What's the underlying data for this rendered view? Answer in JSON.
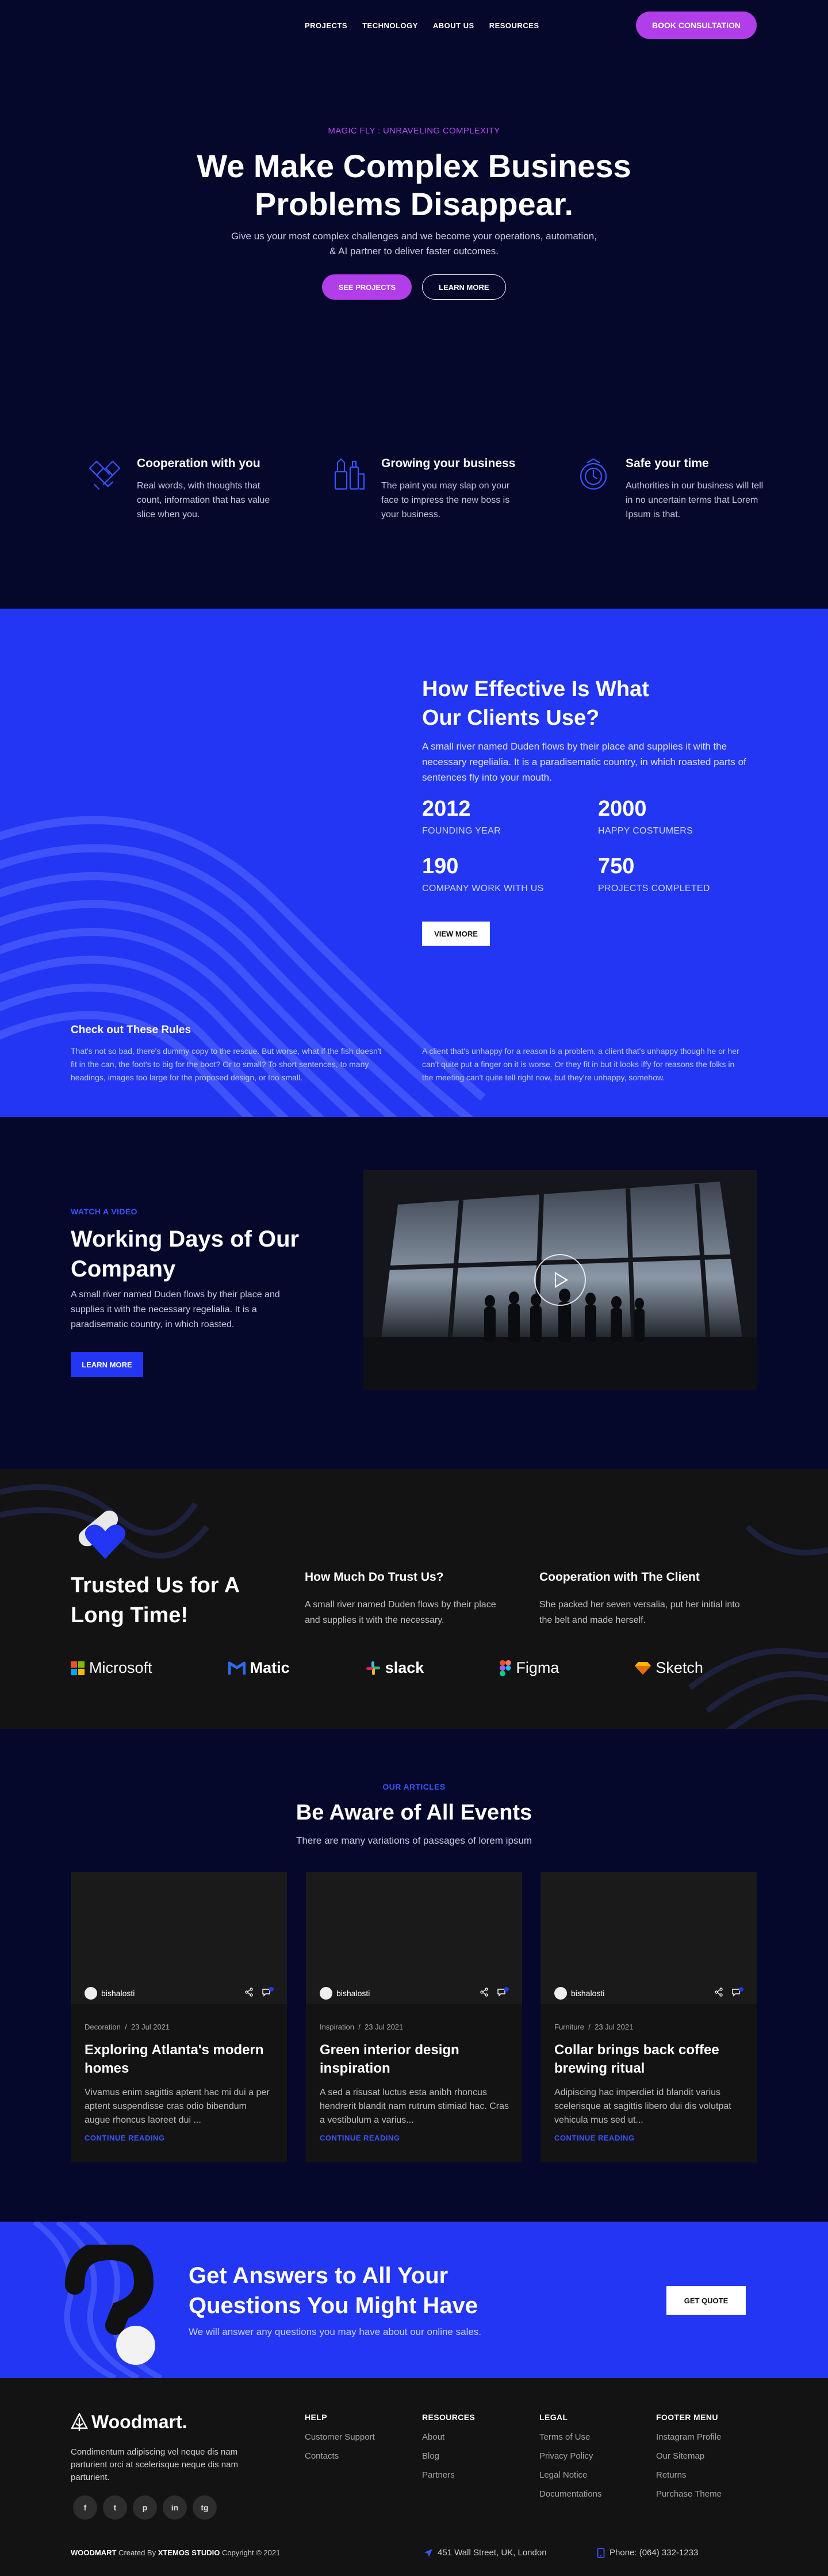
{
  "nav": {
    "links": [
      "PROJECTS",
      "TECHNOLOGY",
      "ABOUT US",
      "RESOURCES"
    ],
    "cta": "BOOK CONSULTATION"
  },
  "hero": {
    "eyebrow": "MAGIC FLY : UNRAVELING COMPLEXITY",
    "title": "We Make Complex Business Problems Disappear.",
    "subtitle": "Give us your most complex challenges and we become your operations, automation, & AI partner to deliver faster outcomes.",
    "primary_button": "SEE PROJECTS",
    "secondary_button": "LEARN MORE"
  },
  "features": [
    {
      "icon": "handshake-icon",
      "title": "Cooperation with you",
      "text": "Real words, with thoughts that count, information that has value slice when you."
    },
    {
      "icon": "office-supplies-icon",
      "title": "Growing your business",
      "text": "The paint you may slap on your face to impress the new boss is your business."
    },
    {
      "icon": "safe-time-icon",
      "title": "Safe your time",
      "text": "Authorities in our business will tell in no uncertain terms that Lorem Ipsum is that."
    }
  ],
  "stats": {
    "title": "How Effective Is What Our Clients Use?",
    "description": "A small river named Duden flows by their place and supplies it with the necessary regelialia. It is a paradisematic country, in which roasted parts of sentences fly into your mouth.",
    "items": [
      {
        "value": "2012",
        "label": "FOUNDING YEAR"
      },
      {
        "value": "2000",
        "label": "HAPPY COSTUMERS"
      },
      {
        "value": "190",
        "label": "COMPANY WORK WITH US"
      },
      {
        "value": "750",
        "label": "PROJECTS COMPLETED"
      }
    ],
    "button": "VIEW MORE",
    "rules_title": "Check out These Rules",
    "rules_left": "That's not so bad, there's dummy copy to the rescue. But worse, what if the fish doesn't fit in the can, the foot's to big for the boot? Or to small? To short sentences, to many headings, images too large for the proposed design, or too small.",
    "rules_right": "A client that's unhappy for a reason is a problem, a client that's unhappy though he or her can't quite put a finger on it is worse. Or they fit in but it looks iffy for reasons the folks in the meeting can't quite tell right now, but they're unhappy, somehow."
  },
  "video": {
    "eyebrow": "WATCH A VIDEO",
    "title": "Working Days of Our Company",
    "description": "A small river named Duden flows by their place and supplies it with the necessary regelialia. It is a paradisematic country, in which roasted.",
    "button": "LEARN MORE"
  },
  "trust": {
    "title": "Trusted Us for A Long Time!",
    "col1_title": "How Much Do Trust Us?",
    "col1_text": "A small river named Duden flows by their place and supplies it with the necessary.",
    "col2_title": "Cooperation with The Client",
    "col2_text": "She packed her seven versalia, put her initial into the belt and made herself.",
    "logos": [
      "Microsoft",
      "Matic",
      "slack",
      "Figma",
      "Sketch"
    ]
  },
  "articles": {
    "eyebrow": "OUR ARTICLES",
    "title": "Be Aware of All Events",
    "subtitle": "There are many variations of passages of lorem ipsum",
    "cards": [
      {
        "author": "bishalosti",
        "category": "Decoration",
        "date": "23 Jul 2021",
        "title": "Exploring Atlanta's modern homes",
        "text": "Vivamus enim sagittis aptent hac mi dui a per aptent suspendisse cras odio bibendum augue rhoncus laoreet dui ...",
        "link": "CONTINUE READING"
      },
      {
        "author": "bishalosti",
        "category": "Inspiration",
        "date": "23 Jul 2021",
        "title": "Green interior design inspiration",
        "text": "A sed a risusat luctus esta anibh rhoncus hendrerit blandit nam rutrum stimiad hac. Cras a vestibulum a varius...",
        "link": "CONTINUE READING"
      },
      {
        "author": "bishalosti",
        "category": "Furniture",
        "date": "23 Jul 2021",
        "title": "Collar brings back coffee brewing ritual",
        "text": "Adipiscing hac imperdiet id blandit varius scelerisque at sagittis libero dui dis volutpat vehicula mus sed ut...",
        "link": "CONTINUE READING"
      }
    ]
  },
  "cta": {
    "title": "Get Answers to All Your Questions You Might Have",
    "subtitle": "We will answer any questions you may have about our online sales.",
    "button": "GET QUOTE"
  },
  "footer": {
    "logo": "Woodmart.",
    "about": "Condimentum adipiscing vel neque dis nam parturient orci at scelerisque neque dis nam parturient.",
    "social": [
      "f",
      "t",
      "p",
      "in",
      "tg"
    ],
    "help_title": "HELP",
    "help_links": [
      "Customer Support",
      "Contacts"
    ],
    "resources_title": "RESOURCES",
    "resources_links": [
      "About",
      "Blog",
      "Partners"
    ],
    "legal_title": "LEGAL",
    "legal_links": [
      "Terms of Use",
      "Privacy Policy",
      "Legal Notice",
      "Documentations"
    ],
    "menu_title": "FOOTER MENU",
    "menu_links": [
      "Instagram Profile",
      "Our Sitemap",
      "Returns",
      "Purchase Theme"
    ],
    "copyright_brand": "WOODMART",
    "copyright_mid": " Created By ",
    "copyright_studio": "XTEMOS STUDIO",
    "copyright_end": " Copyright © 2021",
    "address": "451 Wall Street, UK, London",
    "phone": "Phone: (064) 332-1233"
  },
  "colors": {
    "navy": "#05072b",
    "blue": "#2236f3",
    "purple": "#b13ee8",
    "dark": "#131313"
  }
}
